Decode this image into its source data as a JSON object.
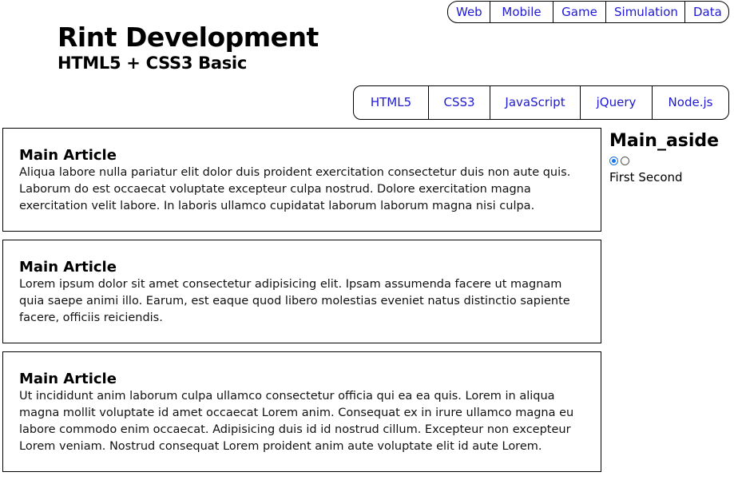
{
  "top_nav": {
    "items": [
      {
        "label": "Web"
      },
      {
        "label": "Mobile"
      },
      {
        "label": "Game"
      },
      {
        "label": "Simulation"
      },
      {
        "label": "Data"
      }
    ]
  },
  "header": {
    "title": "Rint Development",
    "subtitle": "HTML5 + CSS3 Basic"
  },
  "main_nav": {
    "items": [
      {
        "label": "HTML5"
      },
      {
        "label": "CSS3"
      },
      {
        "label": "JavaScript"
      },
      {
        "label": "jQuery"
      },
      {
        "label": "Node.js"
      }
    ]
  },
  "articles": [
    {
      "heading": "Main Article",
      "body": "Aliqua labore nulla pariatur elit dolor duis proident exercitation consectetur duis non aute quis. Laborum do est occaecat voluptate excepteur culpa nostrud. Dolore exercitation magna exercitation velit labore. In laboris ullamco cupidatat laborum laborum magna nisi culpa."
    },
    {
      "heading": "Main Article",
      "body": "Lorem ipsum dolor sit amet consectetur adipisicing elit. Ipsam assumenda facere ut magnam quia saepe animi illo. Earum, est eaque quod libero molestias eveniet natus distinctio sapiente facere, officiis reiciendis."
    },
    {
      "heading": "Main Article",
      "body": "Ut incididunt anim laborum culpa ullamco consectetur officia qui ea ea quis. Lorem in aliqua magna mollit voluptate id amet occaecat Lorem anim. Consequat ex in irure ullamco magna eu labore commodo enim occaecat. Adipisicing duis id id nostrud cillum. Excepteur non excepteur Lorem veniam. Nostrud consequat Lorem proident anim aute voluptate elit id aute Lorem."
    }
  ],
  "aside": {
    "title": "Main_aside",
    "selected_radio": 0,
    "slide_labels": "First Second"
  }
}
